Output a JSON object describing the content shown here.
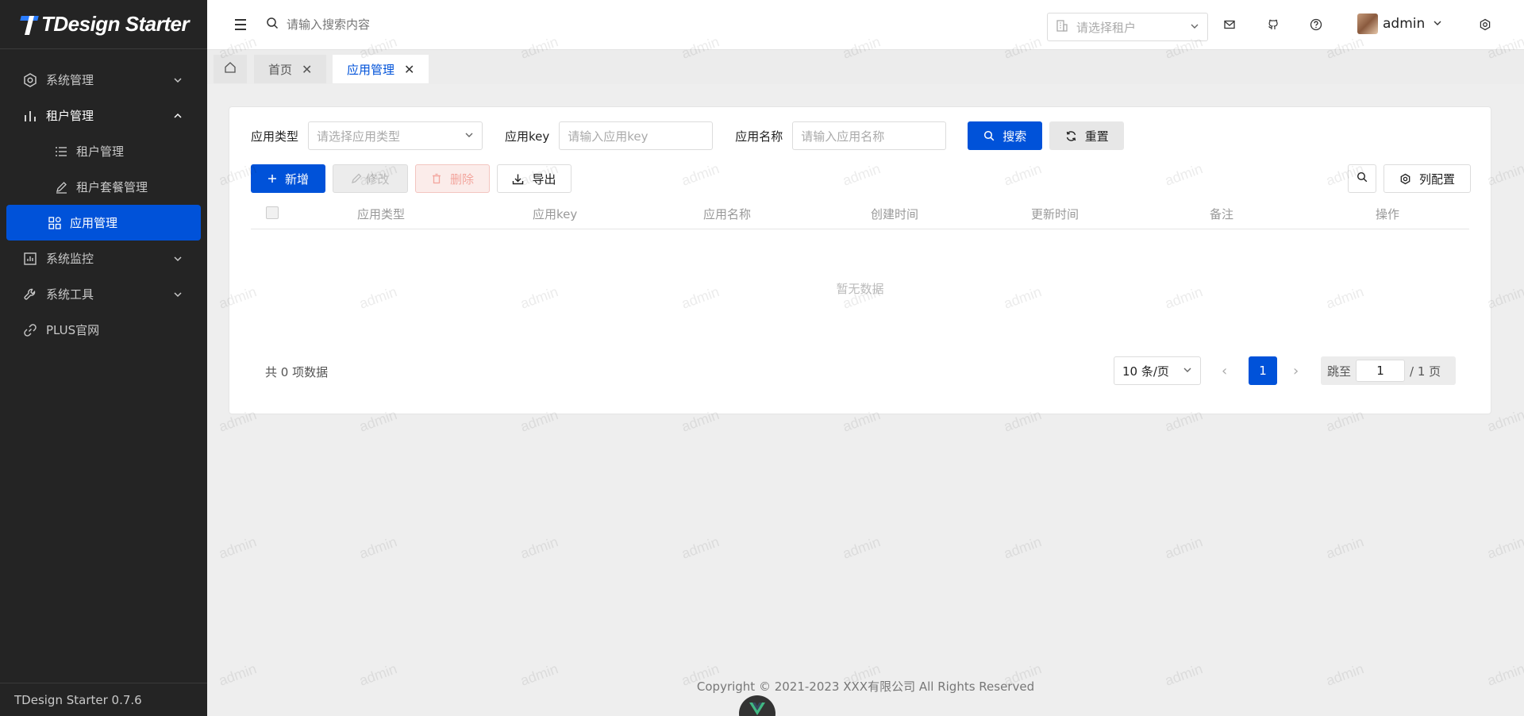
{
  "app": {
    "logo_text": "TDesign Starter",
    "version_text": "TDesign Starter 0.7.6"
  },
  "sidebar": {
    "items": [
      {
        "label": "系统管理",
        "icon": "settings-hexagon-icon",
        "expanded": false
      },
      {
        "label": "租户管理",
        "icon": "bar-chart-icon",
        "expanded": true,
        "children": [
          {
            "label": "租户管理",
            "icon": "list-icon"
          },
          {
            "label": "租户套餐管理",
            "icon": "edit-icon"
          },
          {
            "label": "应用管理",
            "icon": "grid-icon",
            "active": true
          }
        ]
      },
      {
        "label": "系统监控",
        "icon": "chart-monitor-icon",
        "expanded": false
      },
      {
        "label": "系统工具",
        "icon": "wrench-icon",
        "expanded": false
      },
      {
        "label": "PLUS官网",
        "icon": "link-icon"
      }
    ]
  },
  "header": {
    "search_placeholder": "请输入搜索内容",
    "tenant_placeholder": "请选择租户",
    "user_name": "admin"
  },
  "tabs": {
    "items": [
      {
        "label": "首页"
      },
      {
        "label": "应用管理",
        "active": true
      }
    ]
  },
  "filters": {
    "app_type_label": "应用类型",
    "app_type_placeholder": "请选择应用类型",
    "app_key_label": "应用key",
    "app_key_placeholder": "请输入应用key",
    "app_name_label": "应用名称",
    "app_name_placeholder": "请输入应用名称",
    "search_button": "搜索",
    "reset_button": "重置"
  },
  "actions": {
    "add": "新增",
    "edit": "修改",
    "delete": "删除",
    "export": "导出",
    "column_config": "列配置"
  },
  "table": {
    "columns": [
      "应用类型",
      "应用key",
      "应用名称",
      "创建时间",
      "更新时间",
      "备注",
      "操作"
    ],
    "rows": [],
    "empty_text": "暂无数据"
  },
  "pagination": {
    "total_text": "共 0 项数据",
    "page_size": "10 条/页",
    "current_page": "1",
    "jump_label": "跳至",
    "jump_value": "1",
    "total_pages_text": "/ 1 页"
  },
  "footer": {
    "copyright": "Copyright © 2021-2023 XXX有限公司 All Rights Reserved"
  },
  "watermark_text": "admin",
  "colors": {
    "primary": "#0052d9",
    "sidebar_bg": "#242424"
  }
}
